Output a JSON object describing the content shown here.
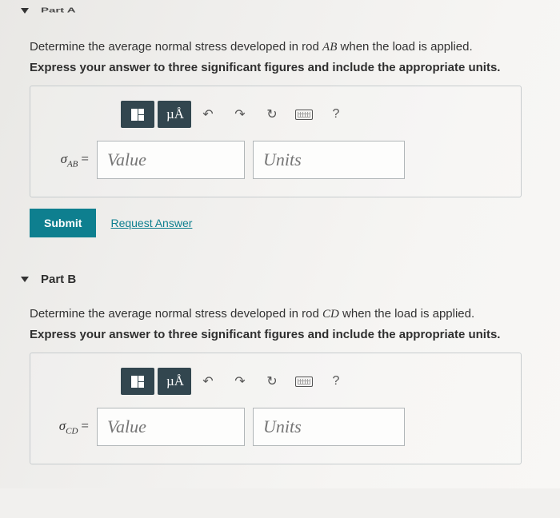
{
  "partA": {
    "label": "Part A",
    "question_pre": "Determine the average normal stress developed in rod ",
    "question_var": "AB",
    "question_post": " when the load is applied.",
    "instruction": "Express your answer to three significant figures and include the appropriate units.",
    "sigma_sub": "AB",
    "value_placeholder": "Value",
    "units_placeholder": "Units",
    "submit": "Submit",
    "request": "Request Answer"
  },
  "partB": {
    "label": "Part B",
    "question_pre": "Determine the average normal stress developed in rod ",
    "question_var": "CD",
    "question_post": " when the load is applied.",
    "instruction": "Express your answer to three significant figures and include the appropriate units.",
    "sigma_sub": "CD",
    "value_placeholder": "Value",
    "units_placeholder": "Units"
  },
  "toolbar": {
    "templates": "templates-icon",
    "units_btn": "µÅ",
    "undo": "↶",
    "redo": "↷",
    "reset": "↻",
    "keyboard": "keyboard-icon",
    "help": "?"
  }
}
